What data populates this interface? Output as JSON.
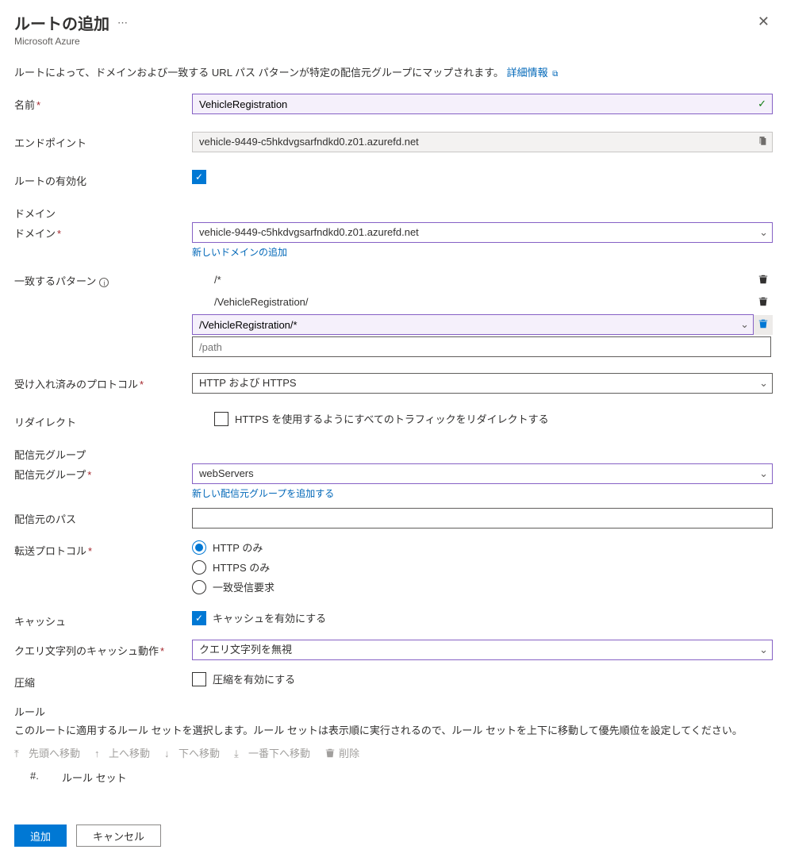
{
  "header": {
    "title": "ルートの追加",
    "subtitle": "Microsoft Azure"
  },
  "intro": {
    "text": "ルートによって、ドメインおよび一致する URL パス パターンが特定の配信元グループにマップされます。",
    "link": "詳細情報"
  },
  "labels": {
    "name": "名前",
    "endpoint": "エンドポイント",
    "enable_route": "ルートの有効化",
    "domain_section": "ドメイン",
    "domain": "ドメイン",
    "add_domain": "新しいドメインの追加",
    "patterns": "一致するパターン",
    "accepted_protocols": "受け入れ済みのプロトコル",
    "redirect": "リダイレクト",
    "redirect_label": "HTTPS を使用するようにすべてのトラフィックをリダイレクトする",
    "origin_group_section": "配信元グループ",
    "origin_group": "配信元グループ",
    "add_origin_group": "新しい配信元グループを追加する",
    "origin_path": "配信元のパス",
    "forward_protocol": "転送プロトコル",
    "cache": "キャッシュ",
    "cache_label": "キャッシュを有効にする",
    "query_string": "クエリ文字列のキャッシュ動作",
    "compression": "圧縮",
    "compression_label": "圧縮を有効にする",
    "rules": "ルール",
    "rules_desc": "このルートに適用するルール セットを選択します。ルール セットは表示順に実行されるので、ルール セットを上下に移動して優先順位を設定してください。",
    "col_num": "#.",
    "col_ruleset": "ルール セット"
  },
  "values": {
    "name": "VehicleRegistration",
    "endpoint": "vehicle-9449-c5hkdvgsarfndkd0.z01.azurefd.net",
    "domain": "vehicle-9449-c5hkdvgsarfndkd0.z01.azurefd.net",
    "patterns": [
      "/*",
      "/VehicleRegistration/"
    ],
    "pattern_editing": "/VehicleRegistration/*",
    "pattern_placeholder": "/path",
    "accepted_protocols": "HTTP および HTTPS",
    "origin_group": "webServers",
    "query_string": "クエリ文字列を無視"
  },
  "forward_protocol": {
    "options": [
      "HTTP のみ",
      "HTTPS のみ",
      "一致受信要求"
    ],
    "selected": 0
  },
  "toolbar": {
    "move_top": "先頭へ移動",
    "move_up": "上へ移動",
    "move_down": "下へ移動",
    "move_bottom": "一番下へ移動",
    "delete": "削除"
  },
  "footer": {
    "add": "追加",
    "cancel": "キャンセル"
  }
}
